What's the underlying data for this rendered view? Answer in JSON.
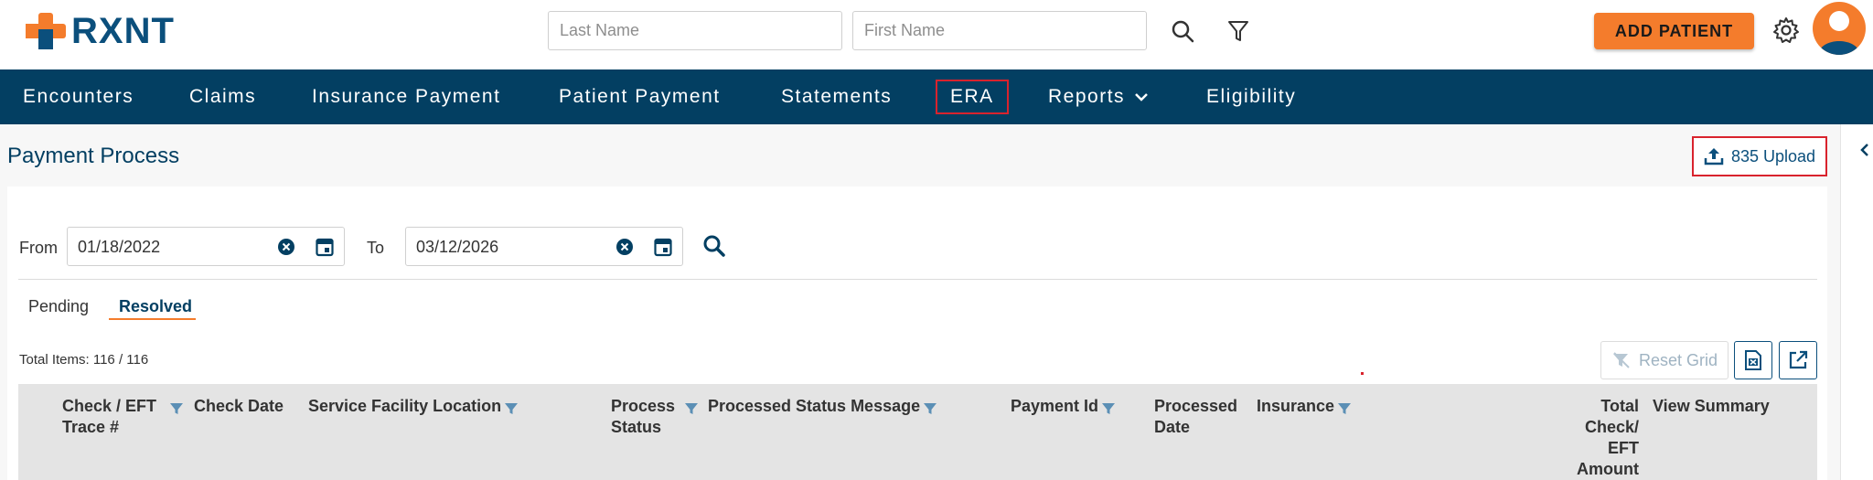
{
  "header": {
    "logo_text": "RXNT",
    "last_name_placeholder": "Last Name",
    "first_name_placeholder": "First Name",
    "add_patient_label": "ADD PATIENT",
    "colors": {
      "brand": "#033f62",
      "accent": "#f47c2c",
      "highlight": "#d9232d"
    }
  },
  "nav": {
    "items": [
      {
        "label": "Encounters"
      },
      {
        "label": "Claims"
      },
      {
        "label": "Insurance Payment"
      },
      {
        "label": "Patient Payment"
      },
      {
        "label": "Statements"
      },
      {
        "label": "ERA"
      },
      {
        "label": "Reports"
      },
      {
        "label": "Eligibility"
      }
    ],
    "active": "ERA"
  },
  "page": {
    "title": "Payment Process",
    "upload_label": "835 Upload"
  },
  "filters": {
    "from_label": "From",
    "from_value": "01/18/2022",
    "to_label": "To",
    "to_value": "03/12/2026"
  },
  "tabs": {
    "items": [
      {
        "label": "Pending"
      },
      {
        "label": "Resolved"
      }
    ],
    "active": "Resolved"
  },
  "grid": {
    "total_items": "Total Items: 116 / 116",
    "reset_label": "Reset Grid",
    "columns": [
      {
        "line1": "Check / EFT",
        "line2": "Trace #",
        "filter": true
      },
      {
        "line1": "Check Date",
        "line2": "",
        "filter": false
      },
      {
        "line1": "Service Facility Location",
        "line2": "",
        "filter": true
      },
      {
        "line1": "Process",
        "line2": "Status",
        "filter": true
      },
      {
        "line1": "Processed Status Message",
        "line2": "",
        "filter": true
      },
      {
        "line1": "Payment Id",
        "line2": "",
        "filter": true
      },
      {
        "line1": "Processed",
        "line2": "Date",
        "filter": false
      },
      {
        "line1": "Insurance",
        "line2": "",
        "filter": true
      },
      {
        "line1": "Total",
        "line2": "Check/",
        "line3": "EFT",
        "line4": "Amount",
        "filter": false
      },
      {
        "line1": "View Summary",
        "line2": "",
        "filter": false
      }
    ]
  }
}
